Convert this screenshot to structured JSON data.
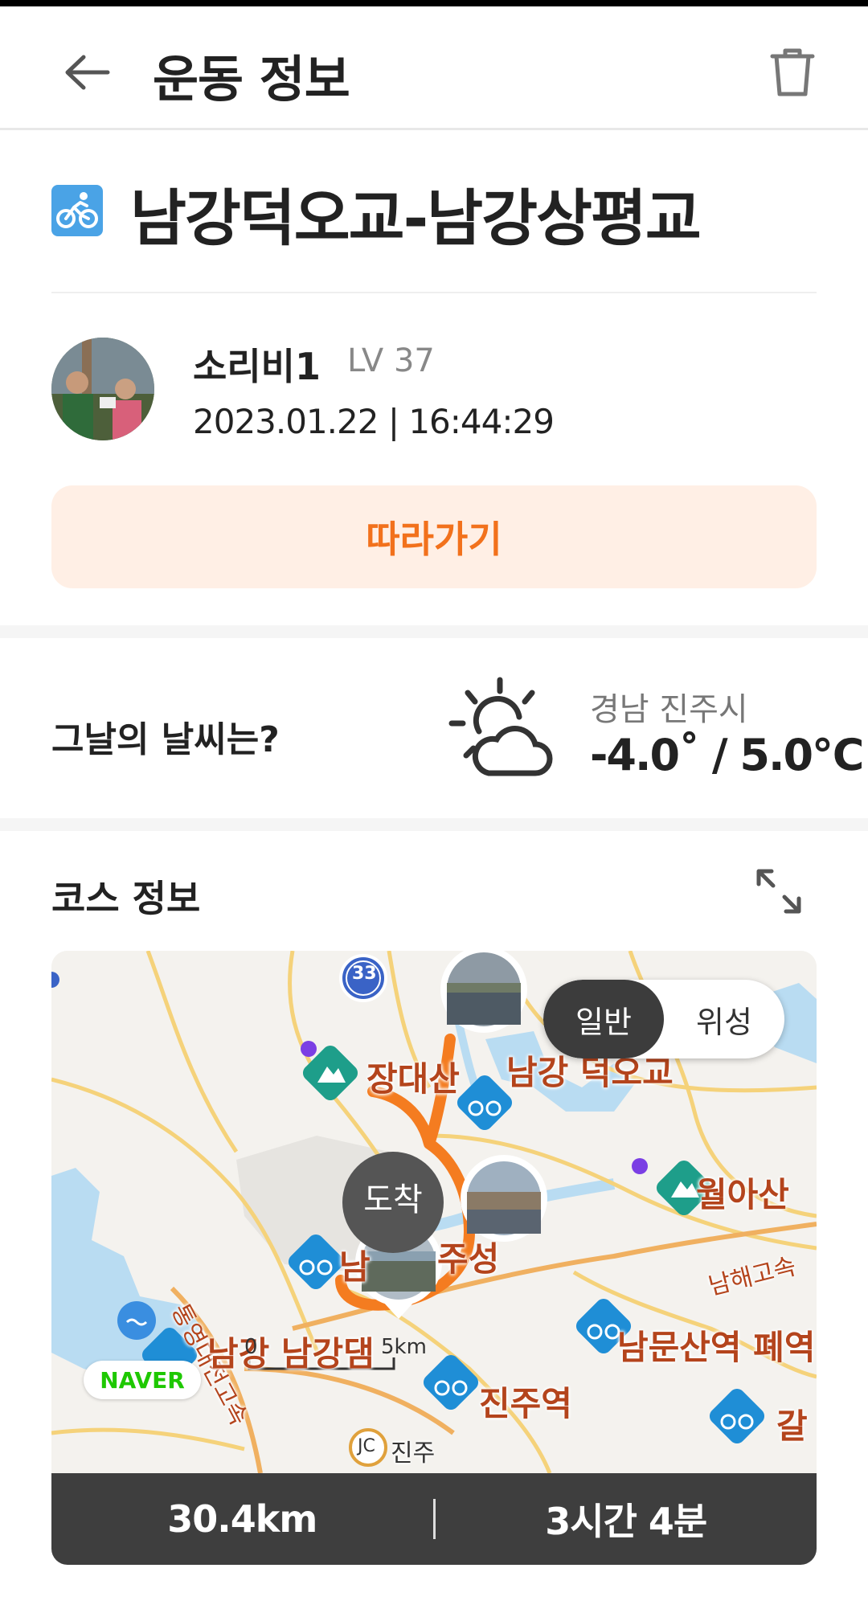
{
  "header": {
    "title": "운동 정보"
  },
  "route": {
    "title": "남강덕오교-남강상평교"
  },
  "user": {
    "name": "소리비1",
    "level": "LV 37",
    "date": "2023.01.22 | 16:44:29"
  },
  "follow_button": {
    "label": "따라가기"
  },
  "weather": {
    "question": "그날의 날씨는?",
    "location": "경남 진주시",
    "temperature": "-4.0˚ / 5.0℃"
  },
  "course": {
    "label": "코스 정보",
    "map": {
      "toggle": {
        "normal": "일반",
        "satellite": "위성",
        "selected": "일반"
      },
      "arrival_label": "도착",
      "provider": "NAVER",
      "scale_start": "0",
      "scale_end": "5km",
      "route_badge": "33",
      "junction_badge": "JC",
      "place_labels": {
        "jangdaesan": "장대산",
        "namgang_deogogyo": "남강 덕오교",
        "wolasan": "월아산",
        "namhae_highway": "남해고속",
        "jinju_fortress": "주성",
        "namgang_dam": "남강 남강댐",
        "namgang_dam_first": "남강",
        "nammunsan_station": "남문산역 폐역",
        "jinju_station": "진주역",
        "jinju_jc": "진주",
        "highway_vertical": "통영대전고속",
        "city_partial": "남",
        "gal_partial": "갈"
      }
    }
  },
  "stats": {
    "distance": "30.4km",
    "duration": "3시간 4분"
  },
  "colors": {
    "accent": "#f2711c",
    "follow_bg": "#ffefe5",
    "route_line": "#f47c20",
    "bike_marker": "#1f8ed6",
    "mountain_marker": "#1e9e8a",
    "stats_bg": "#3e3e3e"
  },
  "icons": {
    "back": "back-arrow-icon",
    "delete": "trash-icon",
    "route_type": "bicycle-icon",
    "weather": "partly-cloudy-icon",
    "expand": "expand-icon"
  }
}
